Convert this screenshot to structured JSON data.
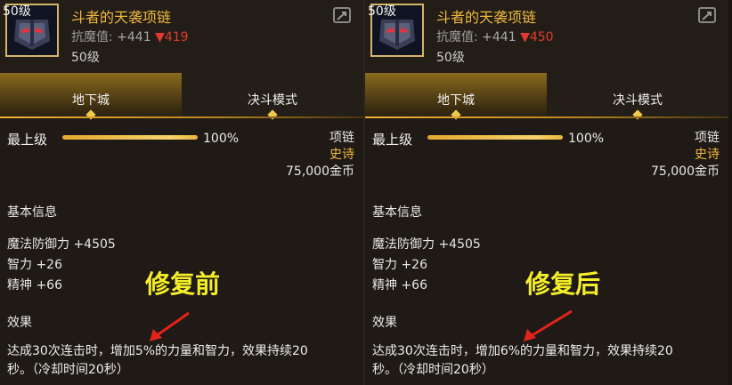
{
  "panels": [
    {
      "level_tag": "50级",
      "item_name": "斗者的天袭项链",
      "stat_name": "抗魔值: ",
      "stat_plus": "+441",
      "stat_arrow": "▼",
      "stat_down": "419",
      "level_sub": "50级",
      "tab_dungeon": "地下城",
      "tab_duel": "决斗模式",
      "grade": "最上级",
      "grade_pct": "100%",
      "progress_fraction": 1.0,
      "item_type": "项链",
      "rarity": "史诗",
      "price": "75,000金币",
      "basic_info_title": "基本信息",
      "attr_magic_def": "魔法防御力 +4505",
      "attr_int": "智力 +26",
      "attr_spirit": "精神 +66",
      "stamp": "修复前",
      "effect_title": "效果",
      "effect_line1": "达成30次连击时，增加5%的力量和智力，效果持续20",
      "effect_line2": "秒。（冷却时间20秒）"
    },
    {
      "level_tag": "50级",
      "item_name": "斗者的天袭项链",
      "stat_name": "抗魔值: ",
      "stat_plus": "+441",
      "stat_arrow": "▼",
      "stat_down": "450",
      "level_sub": "50级",
      "tab_dungeon": "地下城",
      "tab_duel": "决斗模式",
      "grade": "最上级",
      "grade_pct": "100%",
      "progress_fraction": 1.0,
      "item_type": "项链",
      "rarity": "史诗",
      "price": "75,000金币",
      "basic_info_title": "基本信息",
      "attr_magic_def": "魔法防御力 +4505",
      "attr_int": "智力 +26",
      "attr_spirit": "精神 +66",
      "stamp": "修复后",
      "effect_title": "效果",
      "effect_line1": "达成30次连击时，增加6%的力量和智力，效果持续20",
      "effect_line2": "秒。（冷却时间20秒）"
    }
  ],
  "colors": {
    "item_name": "#f0b93d",
    "stat_down": "#e23b2d",
    "stamp": "#f5ee2a",
    "arrow": "#e3231b",
    "background": "#1f1a15"
  },
  "icons": {
    "item_icon": "mask-necklace-icon",
    "share_icon": "share-icon"
  }
}
